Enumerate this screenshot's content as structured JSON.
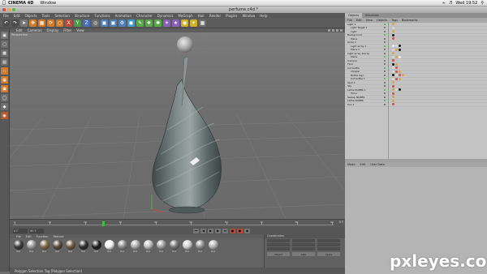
{
  "menubar": {
    "app_name": "CINEMA 4D",
    "window_menu": "Window",
    "clock": "Wed 19:52"
  },
  "window": {
    "title": "perfume.c4d *"
  },
  "app_menu": [
    "File",
    "Edit",
    "Objects",
    "Tools",
    "Selection",
    "Structure",
    "Functions",
    "Animation",
    "Character",
    "Dynamics",
    "MoGraph",
    "Hair",
    "Render",
    "Plugins",
    "Window",
    "Help"
  ],
  "viewport": {
    "menu": [
      "Edit",
      "Cameras",
      "Display",
      "Filter",
      "View"
    ],
    "label": "Perspective"
  },
  "timeline": {
    "tick_labels": [
      "0",
      "10",
      "20",
      "30",
      "40",
      "50",
      "60",
      "70",
      "80",
      "90"
    ],
    "end_frame": "0 F",
    "start_field": "0 F",
    "end_field": "90 F"
  },
  "materials": {
    "menu": [
      "File",
      "Edit",
      "Function",
      "Texture"
    ],
    "items": [
      {
        "label": "Mat",
        "color": "#3d3d3d"
      },
      {
        "label": "Mat",
        "color": "#9a9a9a"
      },
      {
        "label": "Mat",
        "color": "#7e6a48"
      },
      {
        "label": "Mat",
        "color": "#5a4a3a"
      },
      {
        "label": "Mat",
        "color": "#6e5a44"
      },
      {
        "label": "Mat",
        "color": "#2e2e2e"
      },
      {
        "label": "Mat",
        "color": "#1f1f1f"
      },
      {
        "label": "Mat",
        "color": "#f2f2f2"
      },
      {
        "label": "Mat",
        "color": "#8c8c8c"
      },
      {
        "label": "Mat",
        "color": "#a9a9a9"
      },
      {
        "label": "Mat",
        "color": "#bdbdbd"
      },
      {
        "label": "Mat",
        "color": "#9e9e9e"
      },
      {
        "label": "Mat",
        "color": "#777777"
      },
      {
        "label": "Mat",
        "color": "#cfcfcf"
      },
      {
        "label": "Mat",
        "color": "#8f8f8f"
      },
      {
        "label": "Mat",
        "color": "#b2b2b2"
      }
    ]
  },
  "coordinates": {
    "header": "Coordinates",
    "buttons": [
      "Object",
      "Size",
      "Apply"
    ]
  },
  "status": {
    "text": "Polygon Selection Tag [Polygon Selection]"
  },
  "right_panel": {
    "tabs": [
      "Objects",
      "Structure"
    ],
    "menu": [
      "File",
      "Edit",
      "View",
      "Objects",
      "Tags",
      "Bookmarks"
    ],
    "objects": [
      "Light 1",
      "Light Target 1",
      "Light",
      "Background",
      "Plane",
      "Array 1",
      "Light array 1",
      "Plane 1",
      "Light array 1Array",
      "Plane",
      "Camera",
      "Floor",
      "Cnt bottle",
      "stopper",
      "Bottle logo",
      "Cnt bottle 1",
      "Spot 1",
      "Sky",
      "Lathe NURBS 1",
      "Torus",
      "Sweep NURBS",
      "Lathe NURBS",
      "Sun 1"
    ],
    "attr_menu": [
      "Mode",
      "Edit",
      "User Data"
    ]
  },
  "watermark": "pxleyes.com",
  "colors": {
    "accent_green": "#3ac23a",
    "toolbar_orange": "#d07a2a",
    "viewport_bg": "#737373"
  }
}
